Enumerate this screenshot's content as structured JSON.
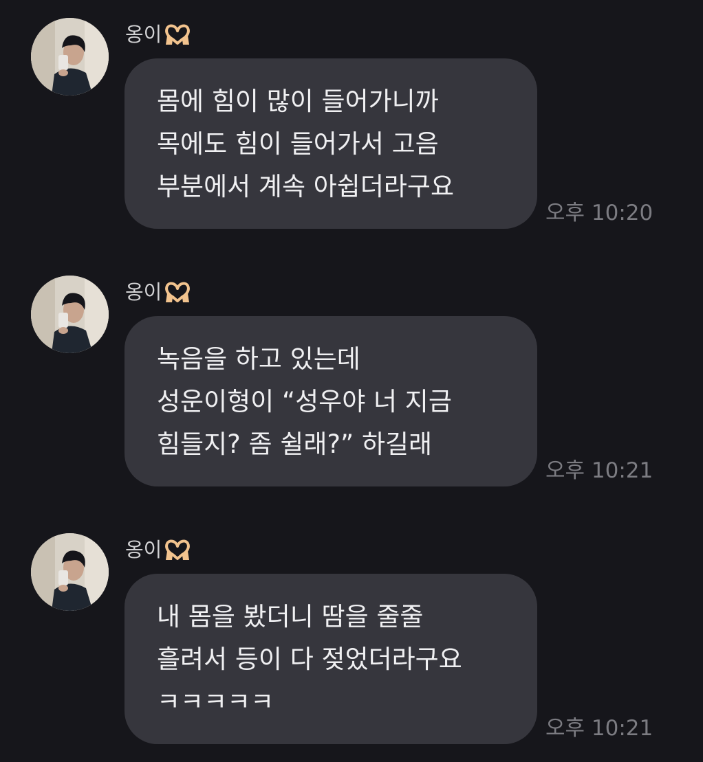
{
  "colors": {
    "background": "#16161b",
    "bubble": "#36363d",
    "message_text": "#f0f0f2",
    "sender_text": "#d2d2d4",
    "timestamp_text": "#7c7c82"
  },
  "messages": [
    {
      "sender": "옹이",
      "sender_emoji_icon": "heart-hands-icon",
      "avatar_icon": "profile-photo-avatar",
      "lines": [
        "몸에 힘이 많이 들어가니까",
        "목에도 힘이 들어가서 고음",
        "부분에서 계속 아쉽더라구요"
      ],
      "time": "오후 10:20"
    },
    {
      "sender": "옹이",
      "sender_emoji_icon": "heart-hands-icon",
      "avatar_icon": "profile-photo-avatar",
      "lines": [
        "녹음을 하고 있는데",
        "성운이형이 “성우야 너 지금",
        "힘들지? 좀 쉴래?” 하길래"
      ],
      "time": "오후 10:21"
    },
    {
      "sender": "옹이",
      "sender_emoji_icon": "heart-hands-icon",
      "avatar_icon": "profile-photo-avatar",
      "lines": [
        "내 몸을 봤더니 땀을 줄줄",
        "흘려서 등이 다 젖었더라구요",
        "ㅋㅋㅋㅋㅋ"
      ],
      "time": "오후 10:21"
    }
  ]
}
